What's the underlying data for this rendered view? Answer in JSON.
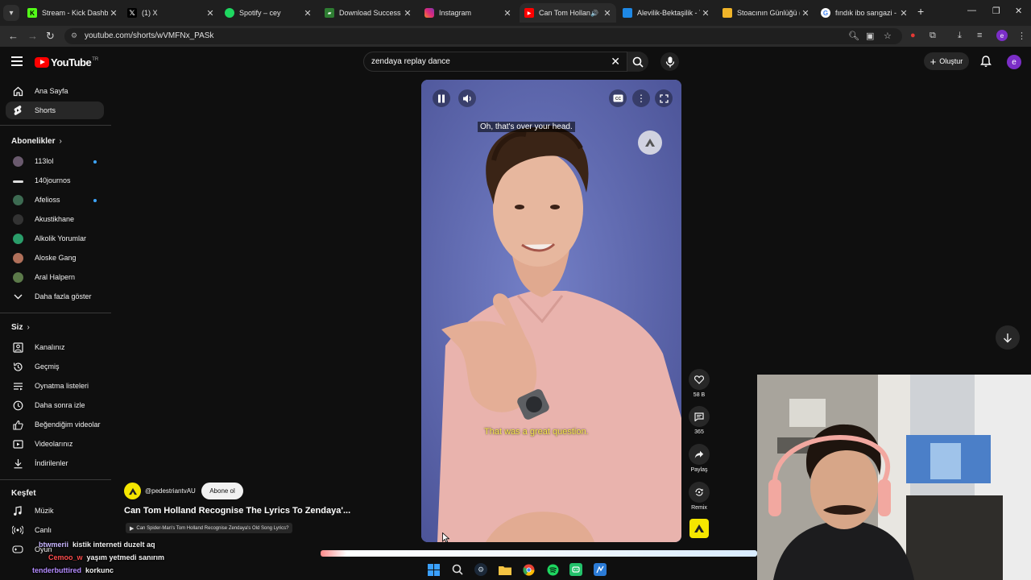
{
  "browser": {
    "tabs": [
      {
        "title": "Stream - Kick Dashbo",
        "icon": "kick-icon",
        "color": "#53fc18"
      },
      {
        "title": "(1) X",
        "icon": "x-icon",
        "color": "#ffffff"
      },
      {
        "title": "Spotify – cey",
        "icon": "spotify-icon",
        "color": "#1ed760"
      },
      {
        "title": "Download Success",
        "icon": "download-icon",
        "color": "#4caf50"
      },
      {
        "title": "Instagram",
        "icon": "instagram-icon",
        "color": "#e1306c"
      },
      {
        "title": "Can Tom Holland",
        "icon": "youtube-icon",
        "color": "#ff0000",
        "active": true
      },
      {
        "title": "Alevilik-Bektaşilik - Te",
        "icon": "site-icon",
        "color": "#1e90ff"
      },
      {
        "title": "Stoacının Günlüğü (R",
        "icon": "book-icon",
        "color": "#f0b429"
      },
      {
        "title": "fındık ibo sarıgazi - G",
        "icon": "google-icon",
        "color": "#4285f4"
      }
    ],
    "url": "youtube.com/shorts/wVMFNx_PASk"
  },
  "youtube": {
    "logo_text": "YouTube",
    "logo_sup": "TR",
    "search": {
      "query": "zendaya replay dance"
    },
    "create_label": "Oluştur",
    "avatar_letter": "e"
  },
  "sidebar": {
    "main": [
      {
        "label": "Ana Sayfa",
        "icon": "home-icon"
      },
      {
        "label": "Shorts",
        "icon": "shorts-icon",
        "active": true
      }
    ],
    "subscriptions_title": "Abonelikler",
    "subscriptions": [
      {
        "label": "113lol",
        "color": "#6a5a6e",
        "dot": true
      },
      {
        "label": "140journos",
        "color": "#dddddd",
        "dot": false
      },
      {
        "label": "Afelioss",
        "color": "#3d6b52",
        "dot": true
      },
      {
        "label": "Akustikhane",
        "color": "#333333",
        "dot": false
      },
      {
        "label": "Alkolik Yorumlar",
        "color": "#2a9d6a",
        "dot": false
      },
      {
        "label": "Aloske Gang",
        "color": "#b0705a",
        "dot": false
      },
      {
        "label": "Aral Halpern",
        "color": "#5c7a4a",
        "dot": false
      }
    ],
    "show_more": "Daha fazla göster",
    "you_title": "Siz",
    "you_items": [
      {
        "label": "Kanalınız",
        "icon": "channel-icon"
      },
      {
        "label": "Geçmiş",
        "icon": "history-icon"
      },
      {
        "label": "Oynatma listeleri",
        "icon": "playlist-icon"
      },
      {
        "label": "Daha sonra izle",
        "icon": "clock-icon"
      },
      {
        "label": "Beğendiğim videolar",
        "icon": "thumb-up-icon"
      },
      {
        "label": "Videolarınız",
        "icon": "video-icon"
      },
      {
        "label": "İndirilenler",
        "icon": "download-icon"
      }
    ],
    "explore_title": "Keşfet",
    "explore_items": [
      {
        "label": "Müzik",
        "icon": "music-icon"
      },
      {
        "label": "Canlı",
        "icon": "live-icon"
      },
      {
        "label": "Oyun",
        "icon": "game-icon"
      }
    ]
  },
  "video": {
    "caption_top": "Oh, that's over your head.",
    "caption_bottom": "That was a great question.",
    "likes": "58 B",
    "comments": "365",
    "share_label": "Paylaş",
    "remix_label": "Remix",
    "channel": "@pedestriantvAU",
    "subscribe_label": "Abone ol",
    "title": "Can Tom Holland Recognise The Lyrics To Zendaya'...",
    "linked_video": "Can Spider-Man's Tom Holland Recognise Zendaya's Old Song Lyrics?"
  },
  "chat": [
    {
      "user": "btwmerii",
      "message": "kistik interneti duzelt aq",
      "color": "#c9b6ff"
    },
    {
      "user": "Cemoo_w",
      "message": "yaşım yetmedi sanırım",
      "color": "#ff4d4d"
    },
    {
      "user": "tenderbuttired",
      "message": "korkunc",
      "color": "#b48cff"
    }
  ],
  "taskbar": [
    {
      "icon": "windows-start-icon",
      "color": "#3aa0ff"
    },
    {
      "icon": "search-icon",
      "color": "#dddddd"
    },
    {
      "icon": "steam-icon",
      "color": "#c7d5e0"
    },
    {
      "icon": "folder-icon",
      "color": "#f5c443"
    },
    {
      "icon": "chrome-icon",
      "color": "#e94235"
    },
    {
      "icon": "spotify-icon",
      "color": "#1ed760"
    },
    {
      "icon": "app-icon",
      "color": "#23c16b"
    },
    {
      "icon": "editor-icon",
      "color": "#2b7bd6"
    }
  ]
}
